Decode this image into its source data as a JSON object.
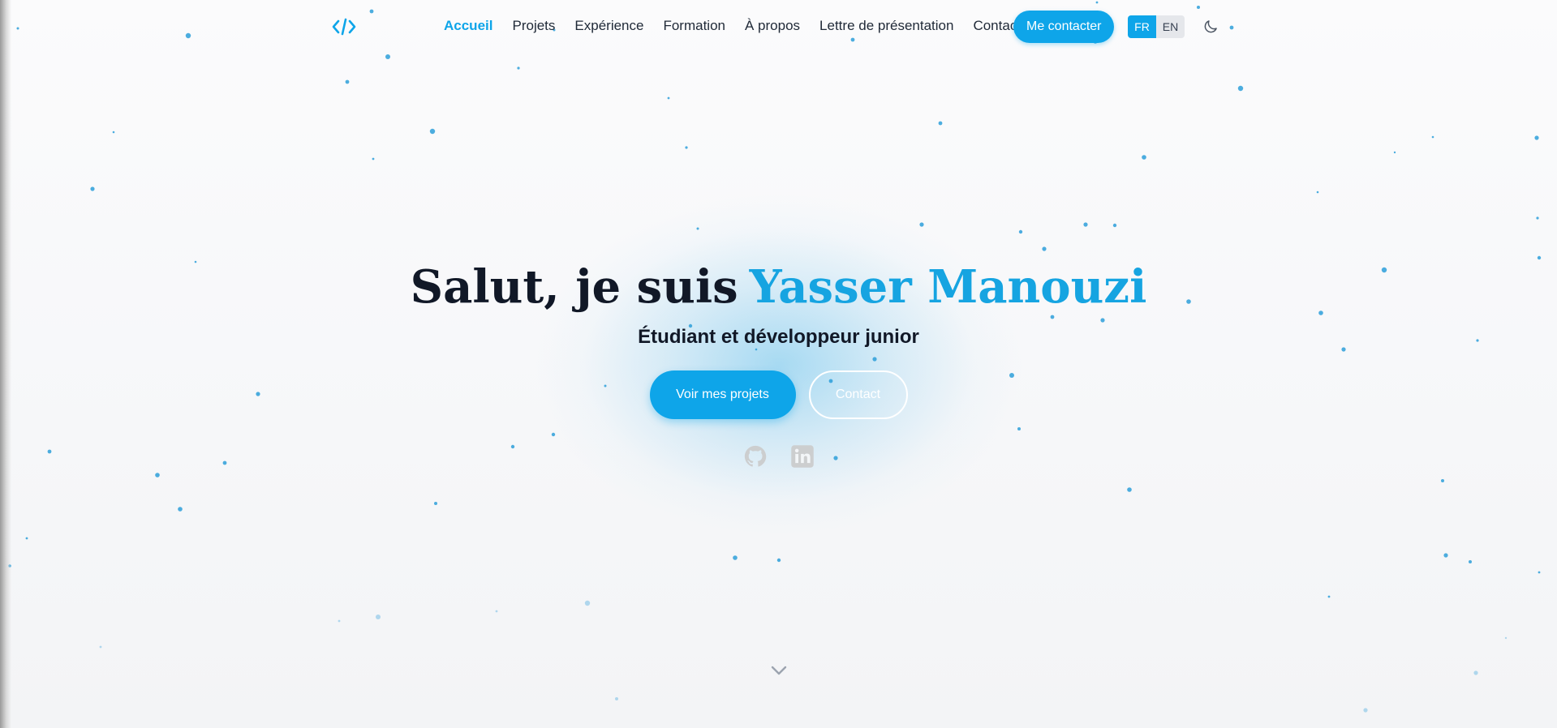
{
  "nav": {
    "logo_icon": "code-brackets-icon",
    "links": [
      {
        "label": "Accueil",
        "active": true
      },
      {
        "label": "Projets",
        "active": false
      },
      {
        "label": "Expérience",
        "active": false
      },
      {
        "label": "Formation",
        "active": false
      },
      {
        "label": "À propos",
        "active": false
      },
      {
        "label": "Lettre de présentation",
        "active": false
      },
      {
        "label": "Contact",
        "active": false
      }
    ],
    "cta_label": "Me contacter",
    "languages": [
      {
        "label": "FR",
        "selected": true
      },
      {
        "label": "EN",
        "selected": false
      }
    ],
    "theme_icon": "moon-icon"
  },
  "hero": {
    "greeting": "Salut, je suis",
    "name": "Yasser Manouzi",
    "subtitle": "Étudiant et développeur junior",
    "primary_button": "Voir mes projets",
    "secondary_button": "Contact",
    "social_icons": [
      "github-icon",
      "linkedin-icon"
    ],
    "scroll_icon": "chevron-down-icon"
  },
  "colors": {
    "accent": "#0ea5e9",
    "name_color": "#16a4e1",
    "text": "#111827",
    "particle": "#2d9fd9",
    "social_icon": "#cbcbcb"
  }
}
